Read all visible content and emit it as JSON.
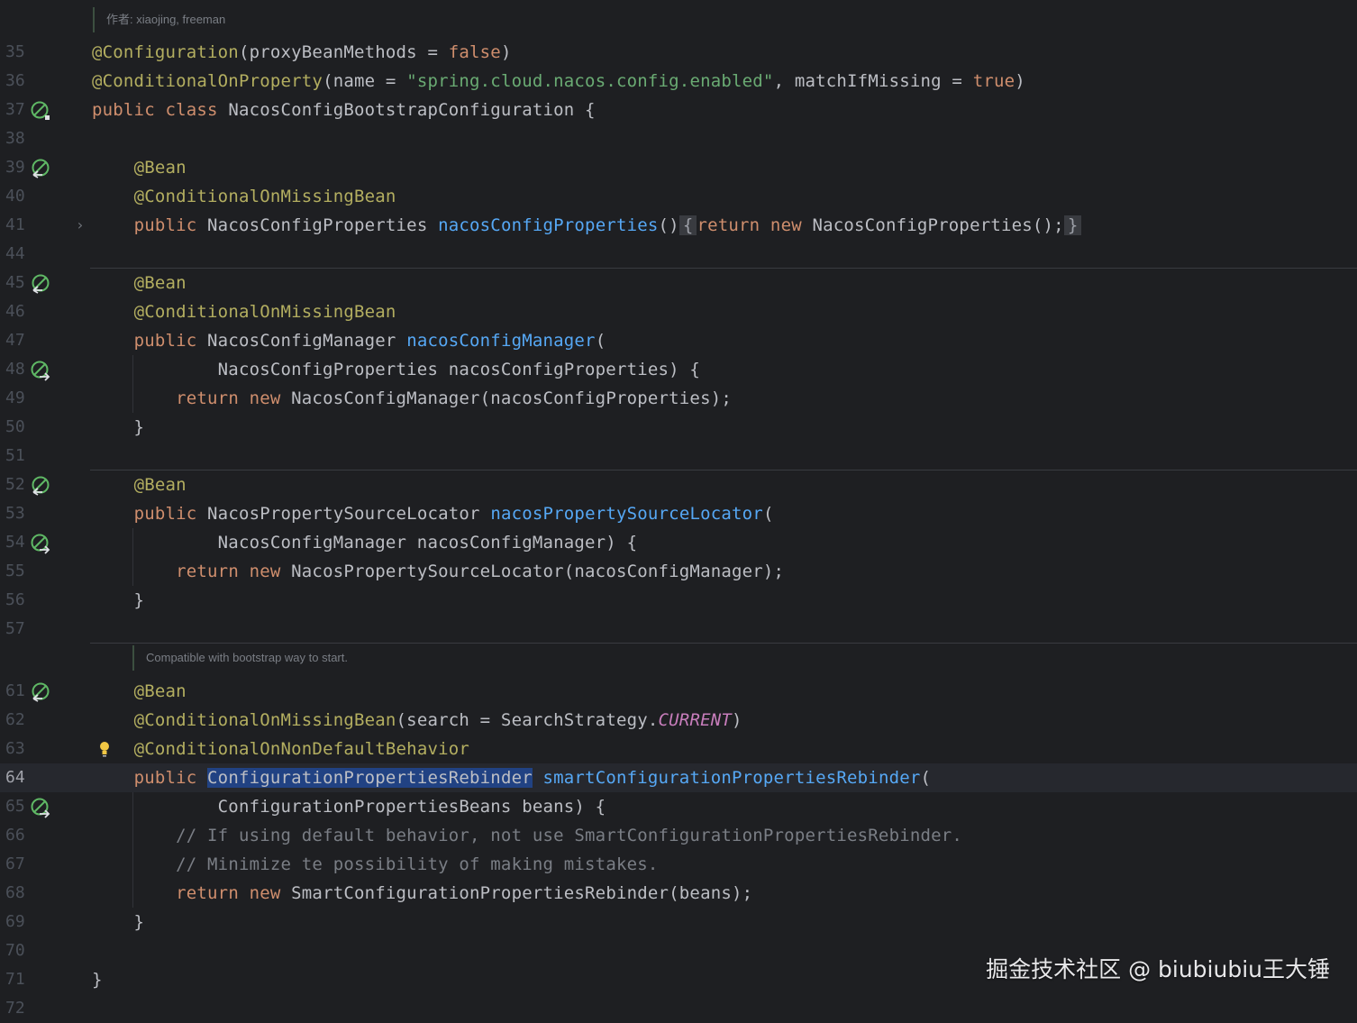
{
  "inlays": {
    "author": "作者: xiaojing, freeman",
    "doc": "Compatible with bootstrap way to start."
  },
  "watermark": "掘金技术社区 @ biubiubiu王大锤",
  "lines": [
    {
      "num": "35",
      "tokens": [
        [
          "ann",
          "@Configuration"
        ],
        [
          "",
          "(proxyBeanMethods = "
        ],
        [
          "kw",
          "false"
        ],
        [
          "",
          ")"
        ]
      ]
    },
    {
      "num": "36",
      "tokens": [
        [
          "ann",
          "@ConditionalOnProperty"
        ],
        [
          "",
          "(name = "
        ],
        [
          "str",
          "\"spring.cloud.nacos.config.enabled\""
        ],
        [
          "",
          ", matchIfMissing = "
        ],
        [
          "kw",
          "true"
        ],
        [
          "",
          ")"
        ]
      ]
    },
    {
      "num": "37",
      "tokens": [
        [
          "kw",
          "public class "
        ],
        [
          "",
          "NacosConfigBootstrapConfiguration {"
        ]
      ]
    },
    {
      "num": "38",
      "tokens": []
    },
    {
      "num": "39",
      "tokens": [
        [
          "",
          "    "
        ],
        [
          "ann",
          "@Bean"
        ]
      ]
    },
    {
      "num": "40",
      "tokens": [
        [
          "",
          "    "
        ],
        [
          "ann",
          "@ConditionalOnMissingBean"
        ]
      ]
    },
    {
      "num": "41",
      "tokens": [
        [
          "",
          "    "
        ],
        [
          "kw",
          "public "
        ],
        [
          "",
          "NacosConfigProperties "
        ],
        [
          "fn",
          "nacosConfigProperties"
        ],
        [
          "",
          "()"
        ],
        [
          "fbox",
          "{"
        ],
        [
          "kw",
          "return new "
        ],
        [
          "",
          "NacosConfigProperties();"
        ],
        [
          "fbox",
          "}"
        ]
      ]
    },
    {
      "num": "44",
      "tokens": []
    },
    {
      "num": "45",
      "tokens": [
        [
          "",
          "    "
        ],
        [
          "ann",
          "@Bean"
        ]
      ]
    },
    {
      "num": "46",
      "tokens": [
        [
          "",
          "    "
        ],
        [
          "ann",
          "@ConditionalOnMissingBean"
        ]
      ]
    },
    {
      "num": "47",
      "tokens": [
        [
          "",
          "    "
        ],
        [
          "kw",
          "public "
        ],
        [
          "",
          "NacosConfigManager "
        ],
        [
          "fn",
          "nacosConfigManager"
        ],
        [
          "",
          "("
        ]
      ]
    },
    {
      "num": "48",
      "tokens": [
        [
          "",
          "            NacosConfigProperties nacosConfigProperties) {"
        ]
      ]
    },
    {
      "num": "49",
      "tokens": [
        [
          "",
          "        "
        ],
        [
          "kw",
          "return new "
        ],
        [
          "",
          "NacosConfigManager(nacosConfigProperties);"
        ]
      ]
    },
    {
      "num": "50",
      "tokens": [
        [
          "",
          "    }"
        ]
      ]
    },
    {
      "num": "51",
      "tokens": []
    },
    {
      "num": "52",
      "tokens": [
        [
          "",
          "    "
        ],
        [
          "ann",
          "@Bean"
        ]
      ]
    },
    {
      "num": "53",
      "tokens": [
        [
          "",
          "    "
        ],
        [
          "kw",
          "public "
        ],
        [
          "",
          "NacosPropertySourceLocator "
        ],
        [
          "fn",
          "nacosPropertySourceLocator"
        ],
        [
          "",
          "("
        ]
      ]
    },
    {
      "num": "54",
      "tokens": [
        [
          "",
          "            NacosConfigManager nacosConfigManager) {"
        ]
      ]
    },
    {
      "num": "55",
      "tokens": [
        [
          "",
          "        "
        ],
        [
          "kw",
          "return new "
        ],
        [
          "",
          "NacosPropertySourceLocator(nacosConfigManager);"
        ]
      ]
    },
    {
      "num": "56",
      "tokens": [
        [
          "",
          "    }"
        ]
      ]
    },
    {
      "num": "57",
      "tokens": []
    },
    {
      "num": "61",
      "tokens": [
        [
          "",
          "    "
        ],
        [
          "ann",
          "@Bean"
        ]
      ]
    },
    {
      "num": "62",
      "tokens": [
        [
          "",
          "    "
        ],
        [
          "ann",
          "@ConditionalOnMissingBean"
        ],
        [
          "",
          "(search = SearchStrategy."
        ],
        [
          "const",
          "CURRENT"
        ],
        [
          "",
          ")"
        ]
      ]
    },
    {
      "num": "63",
      "tokens": [
        [
          "",
          "    "
        ],
        [
          "ann",
          "@ConditionalOnNonDefaultBehavior"
        ]
      ]
    },
    {
      "num": "64",
      "tokens": [
        [
          "",
          "    "
        ],
        [
          "kw",
          "public "
        ],
        [
          "sel",
          "ConfigurationPropertiesRebinder"
        ],
        [
          "",
          " "
        ],
        [
          "fn",
          "smartConfigurationPropertiesRebinder"
        ],
        [
          "",
          "("
        ]
      ]
    },
    {
      "num": "65",
      "tokens": [
        [
          "",
          "            ConfigurationPropertiesBeans beans) {"
        ]
      ]
    },
    {
      "num": "66",
      "tokens": [
        [
          "",
          "        "
        ],
        [
          "cmt",
          "// If using default behavior, not use SmartConfigurationPropertiesRebinder."
        ]
      ]
    },
    {
      "num": "67",
      "tokens": [
        [
          "",
          "        "
        ],
        [
          "cmt",
          "// Minimize te possibility of making mistakes."
        ]
      ]
    },
    {
      "num": "68",
      "tokens": [
        [
          "",
          "        "
        ],
        [
          "kw",
          "return new "
        ],
        [
          "",
          "SmartConfigurationPropertiesRebinder(beans);"
        ]
      ]
    },
    {
      "num": "69",
      "tokens": [
        [
          "",
          "    }"
        ]
      ]
    },
    {
      "num": "70",
      "tokens": []
    },
    {
      "num": "71",
      "tokens": [
        [
          "",
          "}"
        ]
      ]
    },
    {
      "num": "72",
      "tokens": []
    }
  ],
  "gutter_icons": {
    "37": "no-bean-icon",
    "39": "bean-provider-icon",
    "45": "bean-provider-icon",
    "48": "bean-injection-icon",
    "52": "bean-provider-icon",
    "54": "bean-injection-icon",
    "61": "bean-provider-icon",
    "65": "bean-injection-icon"
  },
  "current_line": "64",
  "fold_marker_line": "41",
  "bulb_line": "63",
  "colors": {
    "background": "#1e1f22",
    "keyword": "#cf8e6d",
    "annotation": "#b3ae60",
    "string": "#6aab73",
    "method": "#56a8f5",
    "comment": "#7a7e85",
    "constant": "#c77dbb",
    "selection": "#214283",
    "icon_green": "#5fb865"
  }
}
